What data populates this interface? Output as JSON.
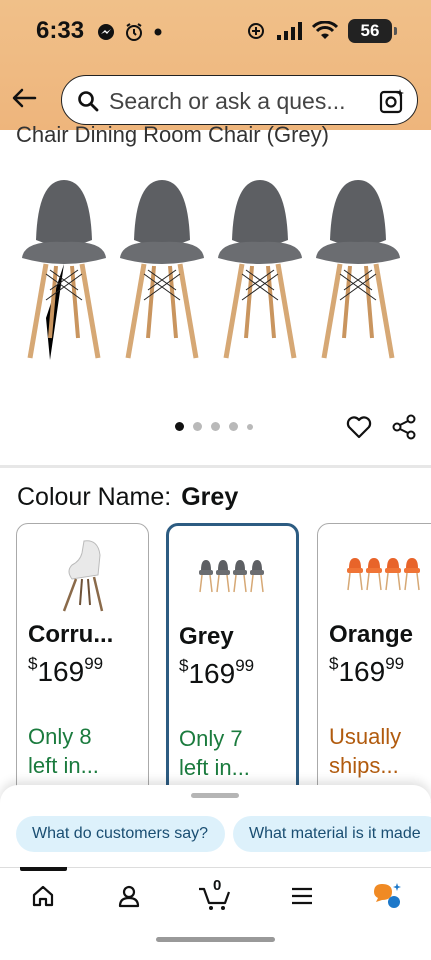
{
  "status_bar": {
    "time": "6:33",
    "battery": "56",
    "icons_left": [
      "messenger-icon",
      "alarm-icon",
      "dot-icon"
    ],
    "icons_right": [
      "data-saver-icon",
      "signal-icon",
      "wifi-icon",
      "battery-icon"
    ]
  },
  "header": {
    "back_icon": "back-arrow-icon",
    "search_placeholder": "Search or ask a ques...",
    "lens_icon": "camera-lens-icon"
  },
  "product": {
    "title_partial": "Chair Dining Room Chair (Grey)",
    "image_count": 5,
    "active_image_index": 0
  },
  "variation": {
    "label": "Colour Name:",
    "selected_value": "Grey",
    "options": [
      {
        "name": "Corru...",
        "currency": "$",
        "price_whole": "169",
        "price_cents": "99",
        "stock_line1": "Only 8",
        "stock_line2": "left in...",
        "stock_color": "#1b7b3e"
      },
      {
        "name": "Grey",
        "currency": "$",
        "price_whole": "169",
        "price_cents": "99",
        "stock_line1": "Only 7",
        "stock_line2": "left in...",
        "stock_color": "#1b7b3e",
        "selected": true
      },
      {
        "name": "Orange",
        "currency": "$",
        "price_whole": "169",
        "price_cents": "99",
        "stock_line1": "Usually",
        "stock_line2": "ships...",
        "stock_color": "#b15b0e"
      }
    ]
  },
  "chips": [
    "What do customers say?",
    "What material is it made"
  ],
  "bottom_nav": {
    "items": [
      "home-icon",
      "account-icon",
      "cart-icon",
      "menu-icon",
      "rufus-icon"
    ],
    "cart_count": "0"
  },
  "colors": {
    "header_bg": "#eeb57c",
    "selected_border": "#2d5c82",
    "in_stock_green": "#1b7b3e",
    "ships_orange": "#b15b0e",
    "chip_bg": "#ddf1fb"
  }
}
